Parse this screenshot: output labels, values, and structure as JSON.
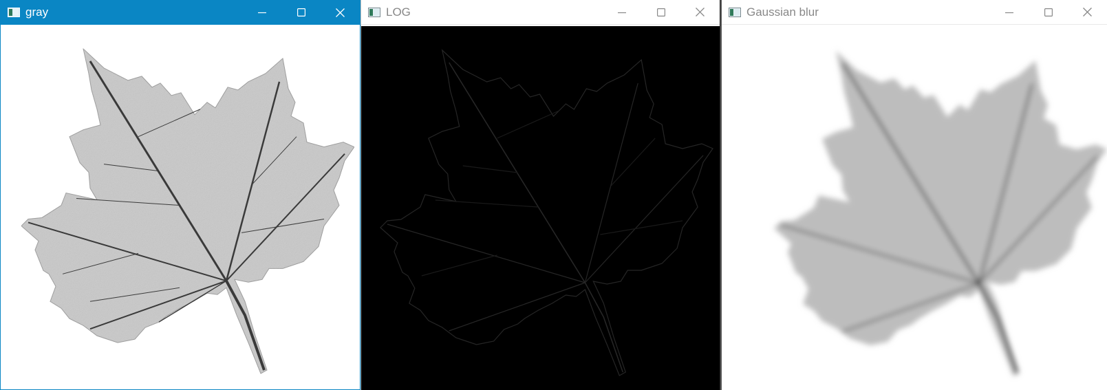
{
  "windows": [
    {
      "title": "gray",
      "icon": "image-window-icon",
      "focused": true
    },
    {
      "title": "LOG",
      "icon": "image-window-icon",
      "focused": false
    },
    {
      "title": "Gaussian blur",
      "icon": "image-window-icon",
      "focused": false
    }
  ],
  "window_controls": [
    "minimize-icon",
    "maximize-icon",
    "close-icon"
  ],
  "colors": {
    "active_titlebar": "#0a86c4",
    "active_title_text": "#ffffff",
    "inactive_title_text": "#888888",
    "log_background": "#000000"
  },
  "images": {
    "gray": "grayscale maple leaf",
    "log": "Laplacian of Gaussian edge response of maple leaf",
    "gaussian_blur": "blurred grayscale maple leaf"
  }
}
